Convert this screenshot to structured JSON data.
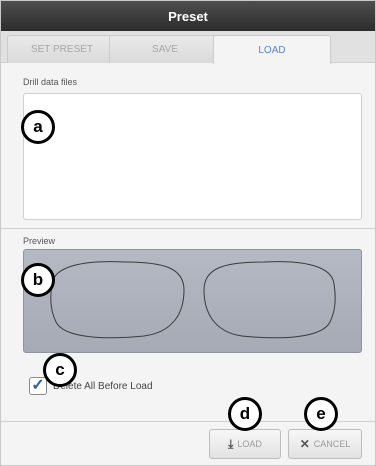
{
  "window": {
    "title": "Preset"
  },
  "tabs": [
    {
      "label": "SET PRESET",
      "active": false
    },
    {
      "label": "SAVE",
      "active": false
    },
    {
      "label": "LOAD",
      "active": true
    }
  ],
  "files": {
    "label": "Drill data files"
  },
  "preview": {
    "label": "Preview"
  },
  "options": {
    "delete_all_label": "Delete All Before Load",
    "delete_all_checked": true
  },
  "buttons": {
    "load_label": "LOAD",
    "cancel_label": "CANCEL"
  },
  "markers": {
    "a": "a",
    "b": "b",
    "c": "c",
    "d": "d",
    "e": "e"
  },
  "colors": {
    "active_tab_text": "#5b86c8",
    "check_color": "#2a5db0",
    "preview_bg": "#b1b5bf"
  },
  "icons": {
    "load": "download-icon",
    "cancel": "close-icon",
    "check": "check-icon"
  }
}
